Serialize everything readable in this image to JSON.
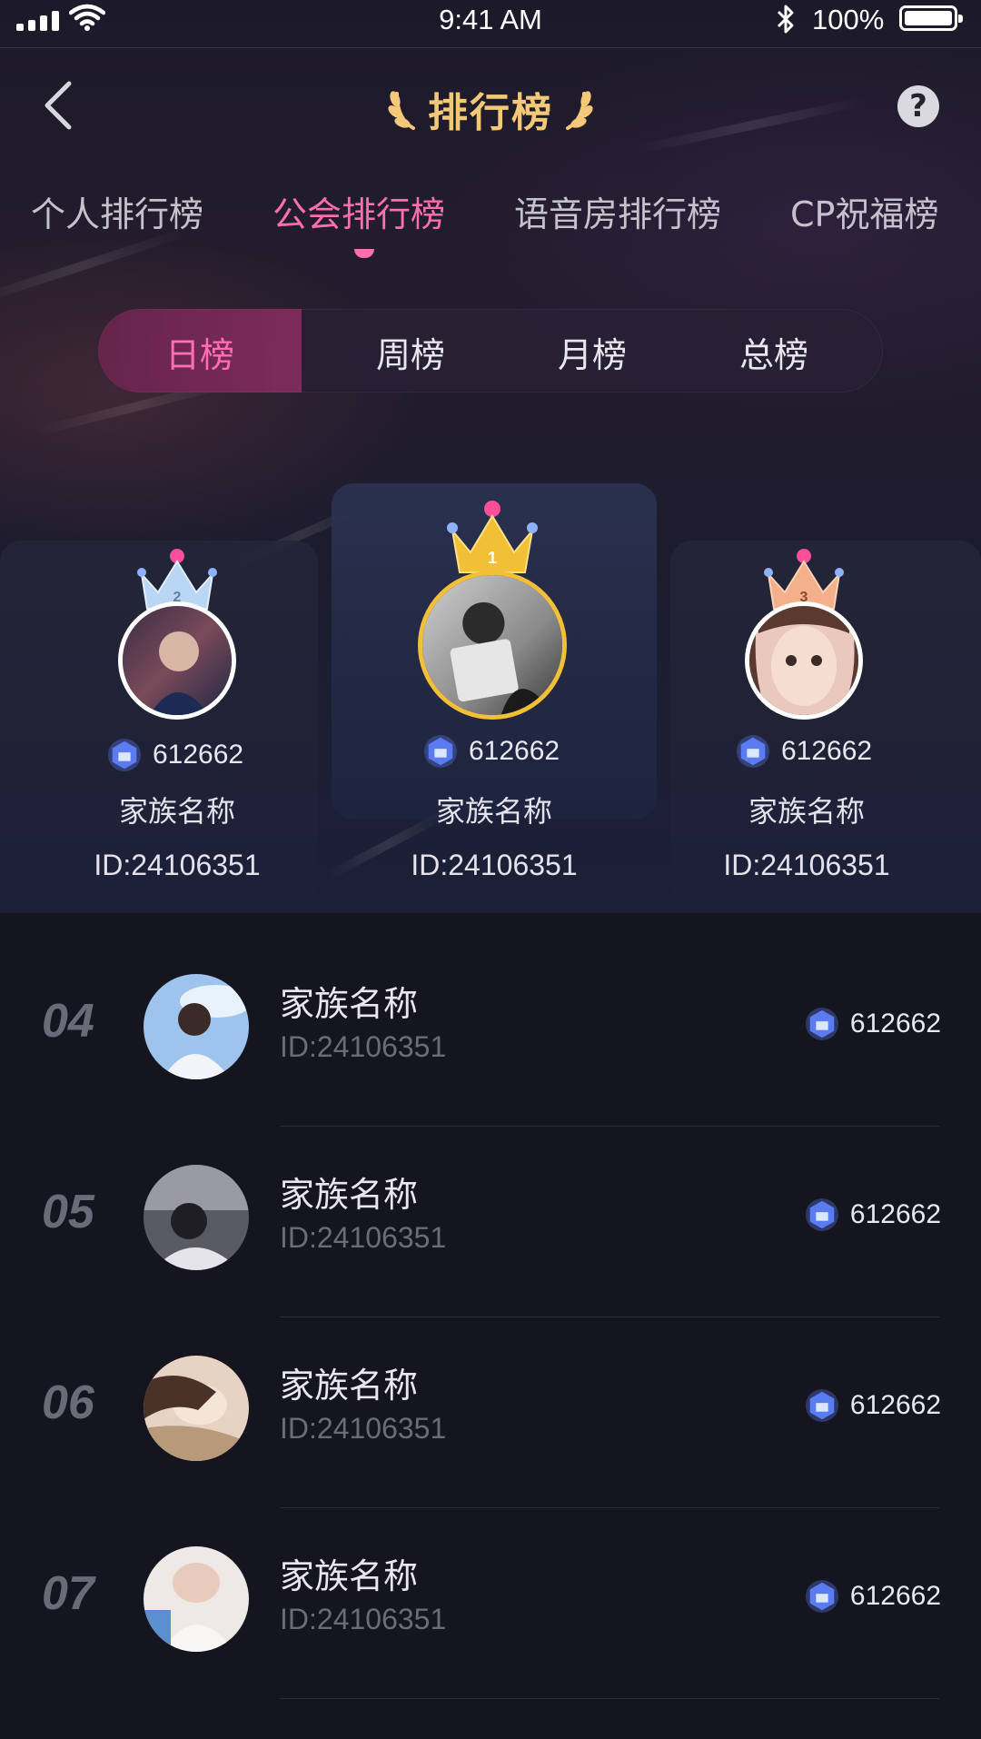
{
  "status_bar": {
    "time": "9:41 AM",
    "battery": "100%"
  },
  "nav": {
    "title": "排行榜",
    "help_label": "?"
  },
  "main_tabs": [
    {
      "label": "个人排行榜",
      "active": false
    },
    {
      "label": "公会排行榜",
      "active": true
    },
    {
      "label": "语音房排行榜",
      "active": false
    },
    {
      "label": "CP祝福榜",
      "active": false
    }
  ],
  "period_tabs": [
    {
      "label": "日榜",
      "active": true
    },
    {
      "label": "周榜",
      "active": false
    },
    {
      "label": "月榜",
      "active": false
    },
    {
      "label": "总榜",
      "active": false
    }
  ],
  "podium": [
    {
      "rank": "1",
      "score": "612662",
      "name": "家族名称",
      "id": "ID:24106351"
    },
    {
      "rank": "2",
      "score": "612662",
      "name": "家族名称",
      "id": "ID:24106351"
    },
    {
      "rank": "3",
      "score": "612662",
      "name": "家族名称",
      "id": "ID:24106351"
    }
  ],
  "list": [
    {
      "rank": "04",
      "name": "家族名称",
      "id": "ID:24106351",
      "score": "612662"
    },
    {
      "rank": "05",
      "name": "家族名称",
      "id": "ID:24106351",
      "score": "612662"
    },
    {
      "rank": "06",
      "name": "家族名称",
      "id": "ID:24106351",
      "score": "612662"
    },
    {
      "rank": "07",
      "name": "家族名称",
      "id": "ID:24106351",
      "score": "612662"
    }
  ],
  "colors": {
    "accent": "#ff6fb0",
    "title_gold": "#f3c878",
    "gold": "#f2c037",
    "score_badge": "#5b7cf0"
  }
}
